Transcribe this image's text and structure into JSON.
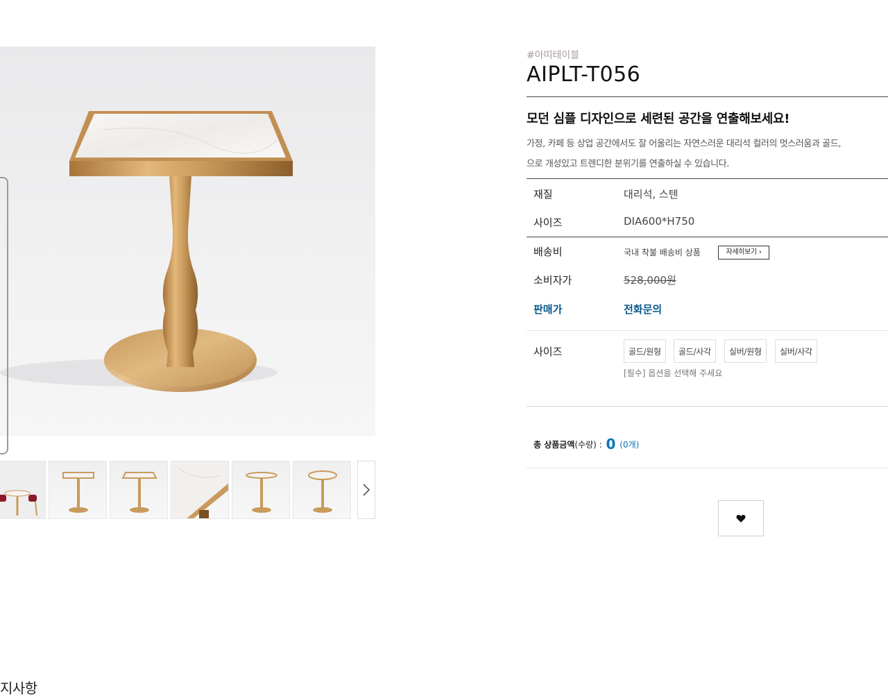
{
  "gallery": {
    "main_image_alt": "",
    "thumbnails": [
      "thumb-chairs",
      "thumb-square-front",
      "thumb-square-side",
      "thumb-marble-closeup",
      "thumb-round-front",
      "thumb-round-side"
    ],
    "next_icon": "chevron-right-icon"
  },
  "notice_tail": "지사항",
  "product": {
    "brand_tag": "#아띠테이블",
    "title": "AIPLT-T056",
    "headline": "모던 심플 디자인으로 세련된 공간을 연출해보세요!",
    "description_line1": "가정, 카페 등 상업 공간에서도 잘 어울리는 자연스러운 대리석 컬러의 멋스러움과 골드,",
    "description_line2": "으로 개성있고 트렌디한 분위기를 연출하실 수 있습니다."
  },
  "specs": [
    {
      "label": "재질",
      "value": "대리석, 스텐"
    },
    {
      "label": "사이즈",
      "value": "DIA600*H750"
    }
  ],
  "shipping": {
    "label": "배송비",
    "value": "국내 착불 배송비 상품",
    "detail_button": "자세히보기 ›"
  },
  "price": {
    "consumer_label": "소비자가",
    "consumer_value": "528,000원",
    "sale_label": "판매가",
    "sale_value": "전화문의"
  },
  "options": {
    "label": "사이즈",
    "choices": [
      "골드/원형",
      "골드/사각",
      "실버/원형",
      "실버/사각"
    ],
    "note": "[필수] 옵션을 선택해 주세요"
  },
  "total": {
    "label": "총 상품금액",
    "qty_label": "(수량) :",
    "amount": "0",
    "count": "(0개)"
  },
  "wishlist": {
    "icon": "heart-icon"
  },
  "colors": {
    "accent": "#0a5a8c",
    "total_accent": "#0a74b8",
    "gold": "#c99a5b",
    "marble": "#f3f1ee"
  }
}
